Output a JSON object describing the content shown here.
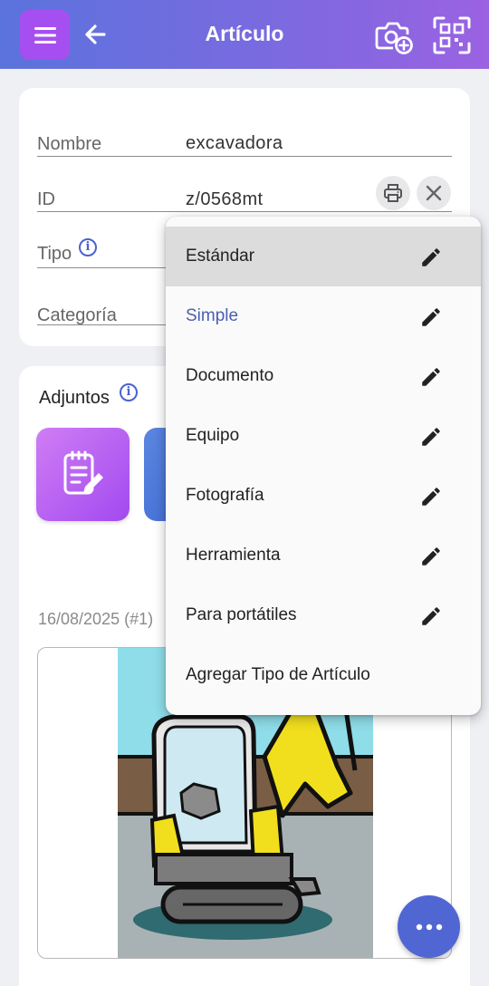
{
  "header": {
    "title": "Artículo"
  },
  "form": {
    "nombre_label": "Nombre",
    "nombre_value": "excavadora",
    "id_label": "ID",
    "id_value": "z/0568mt",
    "tipo_label": "Tipo",
    "categoria_label": "Categoría"
  },
  "attachments": {
    "title": "Adjuntos",
    "date_label": "16/08/2025 (#1)"
  },
  "type_menu": {
    "items": [
      {
        "label": "Estándar",
        "state": "highlighted"
      },
      {
        "label": "Simple",
        "state": "selected"
      },
      {
        "label": "Documento"
      },
      {
        "label": "Equipo"
      },
      {
        "label": "Fotografía"
      },
      {
        "label": "Herramienta"
      },
      {
        "label": "Para portátiles"
      }
    ],
    "add_label": "Agregar Tipo de Artículo"
  },
  "colors": {
    "header_gradient_start": "#5b73dc",
    "header_gradient_end": "#9b62e2",
    "accent": "#4a5fb0",
    "fab": "#5066d2"
  }
}
